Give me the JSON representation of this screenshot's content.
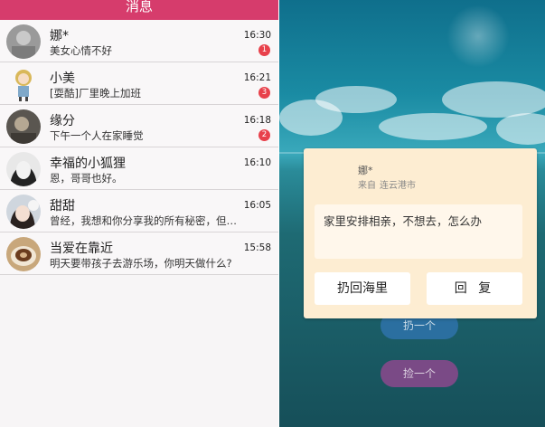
{
  "header": {
    "title": "消息"
  },
  "messages": [
    {
      "name": "娜*",
      "preview": "美女心情不好",
      "time": "16:30",
      "unread": "1",
      "avatar_icon": "avatar-grey-photo"
    },
    {
      "name": "小美",
      "preview": "[耍酷]厂里晚上加班",
      "time": "16:21",
      "unread": "3",
      "avatar_icon": "avatar-cartoon-girl"
    },
    {
      "name": "缘分",
      "preview": "下午一个人在家睡觉",
      "time": "16:18",
      "unread": "2",
      "avatar_icon": "avatar-dark-photo"
    },
    {
      "name": "幸福的小狐狸",
      "preview": "恩，哥哥也好。",
      "time": "16:10",
      "unread": "",
      "avatar_icon": "avatar-bw-photo"
    },
    {
      "name": "甜甜",
      "preview": "曾经，我想和你分享我的所有秘密，但…",
      "time": "16:05",
      "unread": "",
      "avatar_icon": "avatar-girl-photo"
    },
    {
      "name": "当爱在靠近",
      "preview": "明天要带孩子去游乐场，你明天做什么?",
      "time": "15:58",
      "unread": "",
      "avatar_icon": "avatar-coffee-photo"
    }
  ],
  "ocean": {
    "throw_label": "扔一个",
    "pick_label": "捡一个"
  },
  "dialog": {
    "sender": "娜*",
    "from_label": "来自",
    "from_place": "连云港市",
    "message": "家里安排相亲，不想去，怎么办",
    "throwback_label": "扔回海里",
    "reply_label": "回 复"
  },
  "colors": {
    "accent": "#d63c6c",
    "badge": "#e8414b",
    "dialog_bg": "#fdedd2"
  }
}
